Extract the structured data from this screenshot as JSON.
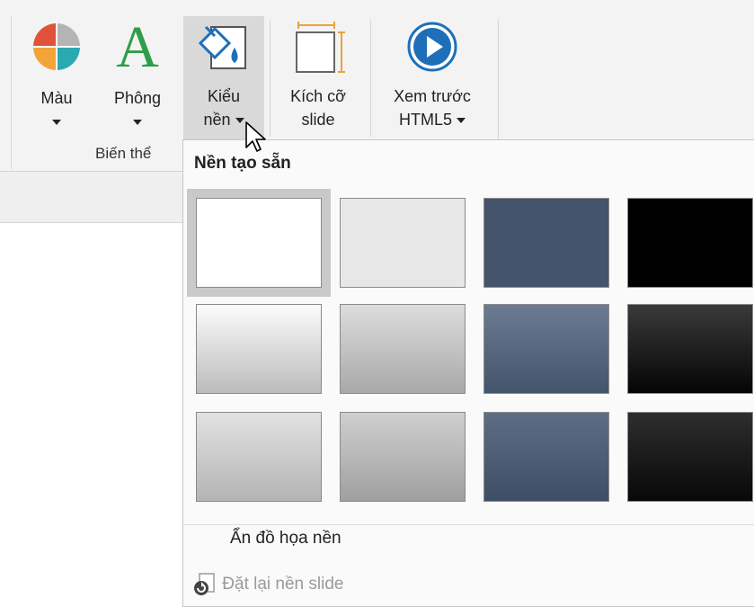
{
  "ribbon": {
    "colors_button": {
      "label": "Màu",
      "icon": "color-palette-icon"
    },
    "fonts_button": {
      "label": "Phông",
      "icon": "font-a-icon"
    },
    "background_button": {
      "label_line1": "Kiểu",
      "label_line2": "nền",
      "icon": "paint-bucket-icon"
    },
    "slide_size_button": {
      "label_line1": "Kích cỡ",
      "label_line2": "slide",
      "icon": "slide-size-icon"
    },
    "preview_button": {
      "label_line1": "Xem trước",
      "label_line2": "HTML5",
      "icon": "play-circle-icon"
    },
    "group_label": "Biến thể"
  },
  "dropdown": {
    "section_title": "Nền tạo sẵn",
    "hide_graphics": "Ẩn đồ họa nền",
    "reset_background": "Đặt lại nền slide",
    "reset_icon": "reset-background-icon",
    "selected_index": 0,
    "tiles": [
      {
        "name": "white-solid",
        "color": "#ffffff"
      },
      {
        "name": "light-gray-solid",
        "color": "#e7e7e7"
      },
      {
        "name": "slate-blue-solid",
        "color": "#44546a"
      },
      {
        "name": "black-solid",
        "color": "#000000"
      },
      {
        "name": "white-gradient",
        "color": "#dedede"
      },
      {
        "name": "gray-gradient",
        "color": "#c4c4c4"
      },
      {
        "name": "slate-blue-gradient",
        "color": "#5b6a80"
      },
      {
        "name": "black-gradient",
        "color": "#202020"
      },
      {
        "name": "white-gradient-2",
        "color": "#d8d8d8"
      },
      {
        "name": "gray-gradient-2",
        "color": "#bdbdbd"
      },
      {
        "name": "slate-blue-gradient-2",
        "color": "#56657c"
      },
      {
        "name": "black-gradient-2",
        "color": "#1a1a1a"
      }
    ]
  }
}
